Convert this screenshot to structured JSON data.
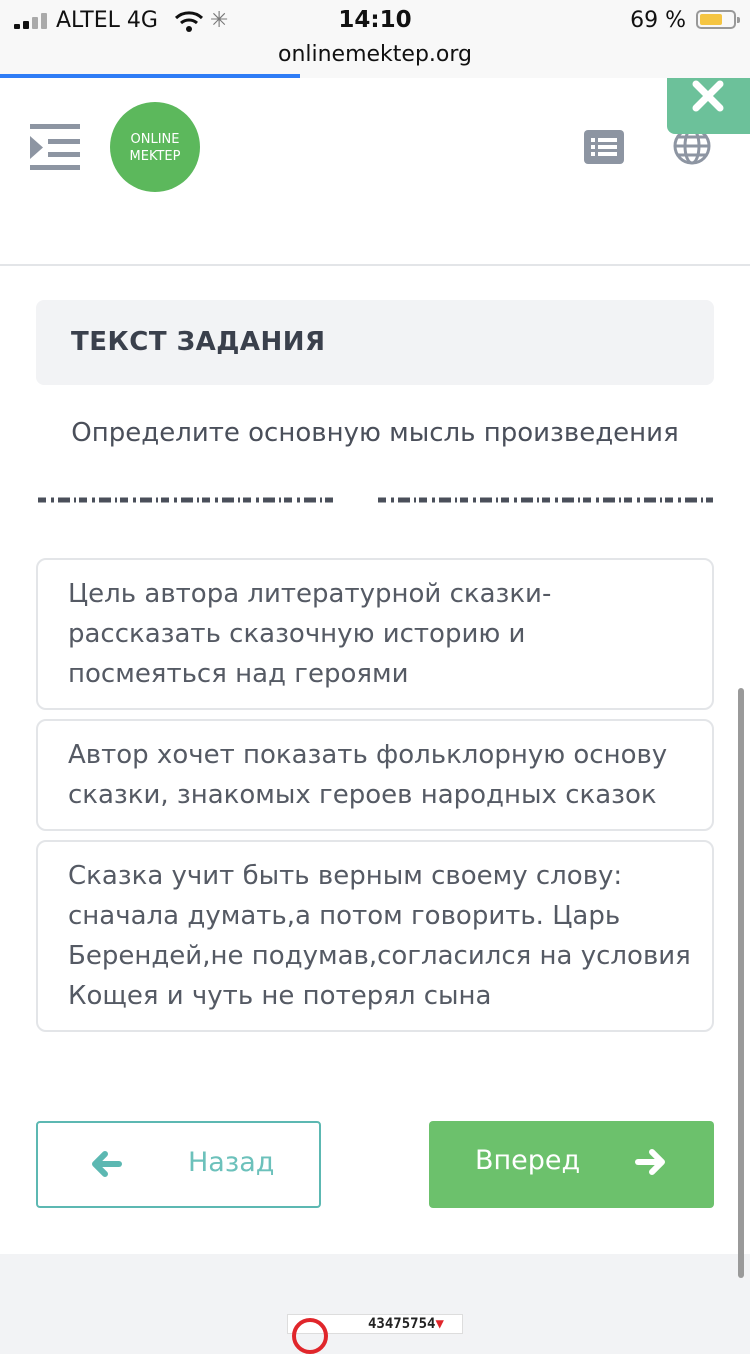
{
  "status_bar": {
    "carrier": "ALTEL 4G",
    "time": "14:10",
    "battery_percent": "69 %",
    "battery_level": 0.69,
    "icons": [
      "signal-icon",
      "wifi-icon",
      "loading-spinner-icon",
      "battery-icon"
    ]
  },
  "browser": {
    "url": "onlinemektep.org",
    "load_progress": 0.4
  },
  "header": {
    "logo_line1": "ONLINE",
    "logo_line2": "MEKTEP",
    "brand_color": "#5cb85c",
    "icons": [
      "menu-indent-icon",
      "list-icon",
      "globe-icon",
      "close-icon"
    ]
  },
  "task": {
    "title": "ТЕКСТ ЗАДАНИЯ",
    "question": "Определите основную мысль произведения"
  },
  "options": [
    {
      "text": "Цель автора литературной сказки-рассказать сказочную историю и посмеяться над героями"
    },
    {
      "text": "Автор хочет показать фольклорную основу сказки, знакомых героев народных сказок"
    },
    {
      "text": "Сказка учит быть верным своему слову: сначала думать,а потом говорить. Царь Берендей,не подумав,согласился на условия Кощея и чуть не потерял сына"
    }
  ],
  "navigation": {
    "back_label": "Назад",
    "next_label": "Вперед",
    "back_color": "#5cb8b2",
    "next_color": "#6cc16c"
  },
  "ad": {
    "number": "43475754"
  }
}
